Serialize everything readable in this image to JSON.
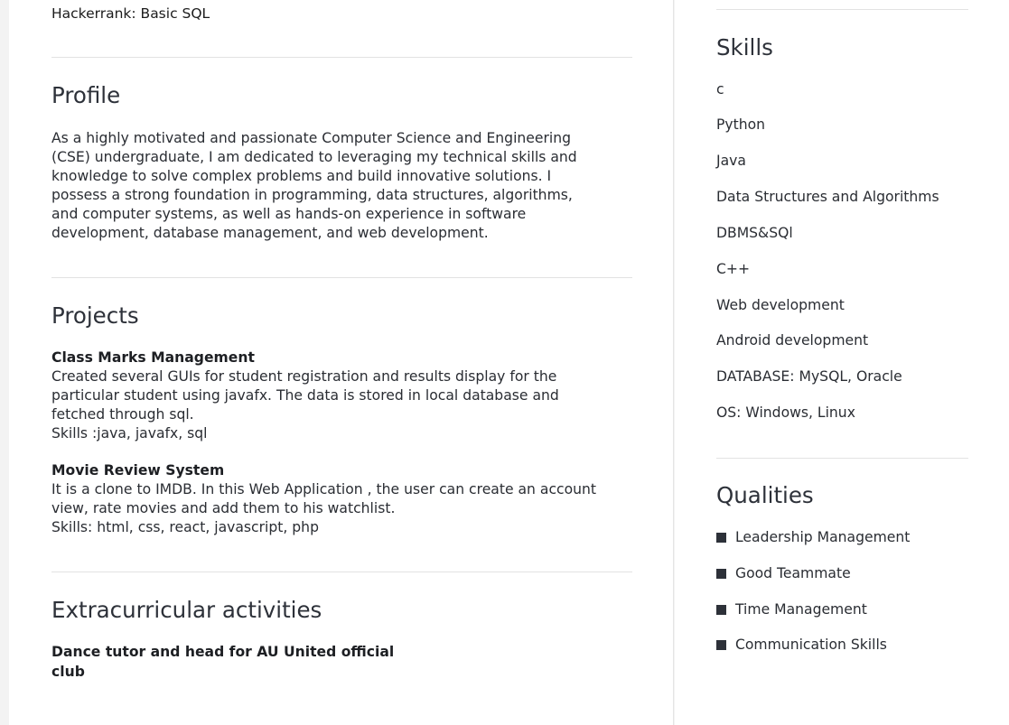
{
  "main": {
    "certification": "Hackerrank: Basic SQL",
    "profile": {
      "title": "Profile",
      "lines": [
        "As a highly motivated and passionate Computer Science and Engineering",
        "(CSE) undergraduate, I am dedicated to leveraging my technical skills and",
        "knowledge to solve complex problems and build innovative solutions. I",
        "possess a strong foundation in programming, data structures, algorithms,",
        "and computer systems, as well as hands-on experience in software",
        "development, database management, and web development."
      ]
    },
    "projects": {
      "title": "Projects",
      "items": [
        {
          "name": "Class Marks Management",
          "lines": [
            "Created several GUIs for student registration and results display for the",
            "particular student using javafx. The data is stored in local database and",
            "fetched through sql.",
            "Skills :java, javafx, sql"
          ]
        },
        {
          "name": "Movie Review System",
          "lines": [
            "It is a clone to IMDB. In this Web Application , the user can create an account",
            "view, rate movies and add them to his watchlist.",
            "Skills: html, css, react, javascript, php"
          ]
        }
      ]
    },
    "extracurricular": {
      "title": "Extracurricular activities",
      "lines": [
        "Dance tutor and head for AU United official",
        "club"
      ]
    }
  },
  "aside": {
    "skills": {
      "title": "Skills",
      "items": [
        "c",
        "Python",
        "Java",
        "Data Structures and Algorithms",
        "DBMS&SQl",
        "C++",
        "Web development",
        "Android development",
        "DATABASE: MySQL, Oracle",
        "OS: Windows, Linux"
      ]
    },
    "qualities": {
      "title": "Qualities",
      "items": [
        "Leadership Management",
        "Good Teammate",
        "Time Management",
        "Communication Skills"
      ]
    }
  },
  "colors": {
    "page_bg": "#f3f3f3",
    "card_bg": "#ffffff",
    "heading": "#2d3139",
    "bullet": "#2d3139",
    "divider": "#e2e2e2"
  }
}
